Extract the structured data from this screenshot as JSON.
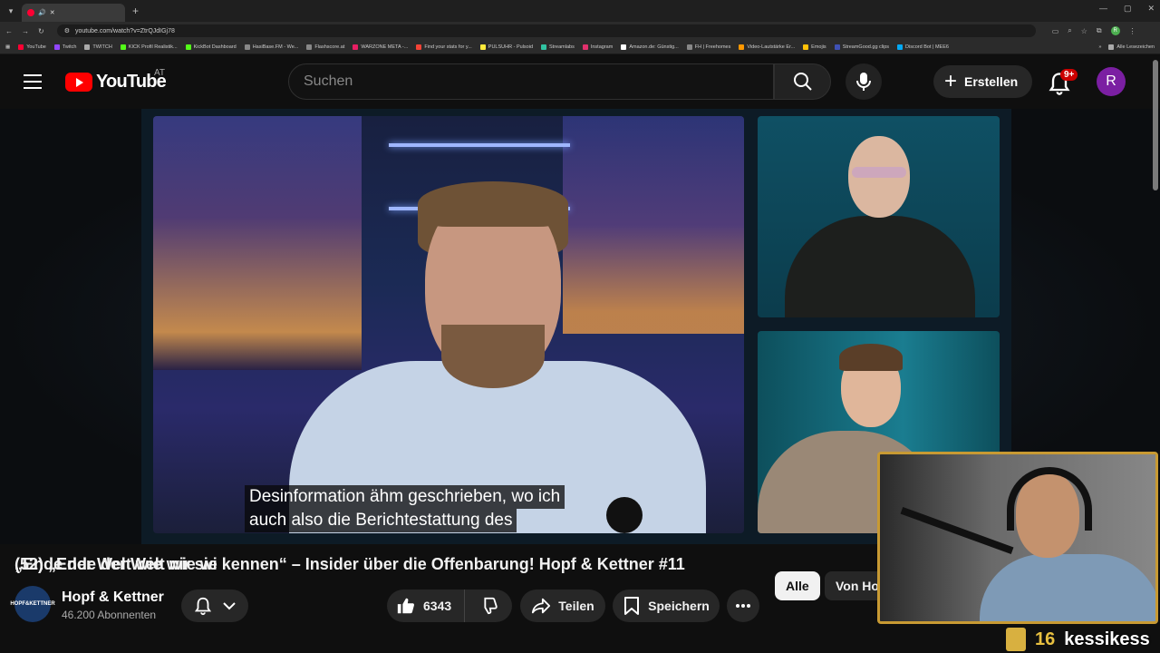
{
  "browser": {
    "tab_title": "(52) „Ende der Welt wie wi",
    "url": "youtube.com/watch?v=ZtrQJdIGj78",
    "bookmarks": [
      "YouTube",
      "Twitch",
      "TWITCH",
      "KICK Profil Realistik...",
      "KickBot Dashboard",
      "HasiBase.FM - We...",
      "Flashscore.at",
      "WARZONE META -...",
      "Find your stats for y...",
      "PULSUHR - Pulsoid",
      "Streamlabs",
      "Instagram",
      "Amazon.de: Günstig...",
      "FH | Freehomes",
      "Video-Lautstärke Er...",
      "Emojis",
      "StreamGood.gg clips",
      "Discord Bot | MEE6"
    ],
    "bookmarks_all": "Alle Lesezeichen"
  },
  "youtube": {
    "country_code": "AT",
    "search_placeholder": "Suchen",
    "create_label": "Erstellen",
    "notification_badge": "9+",
    "avatar_letter": "R"
  },
  "video": {
    "subtitle_line1": "Desinformation ähm geschrieben, wo ich",
    "subtitle_line2": "auch also die Berichtestattung des",
    "title": "„Ende der Welt wie wir sie kennen“ – Insider über die Offenbarung! Hopf & Kettner #11",
    "channel_name": "Hopf & Kettner",
    "channel_logo_text": "HOPF&KETTNER",
    "subscribers": "46.200 Abonnenten",
    "likes": "6343",
    "share_label": "Teilen",
    "save_label": "Speichern"
  },
  "chips": {
    "all": "Alle",
    "from": "Von Ho"
  },
  "stream_overlay": {
    "count": "16",
    "name": "kessikess"
  }
}
